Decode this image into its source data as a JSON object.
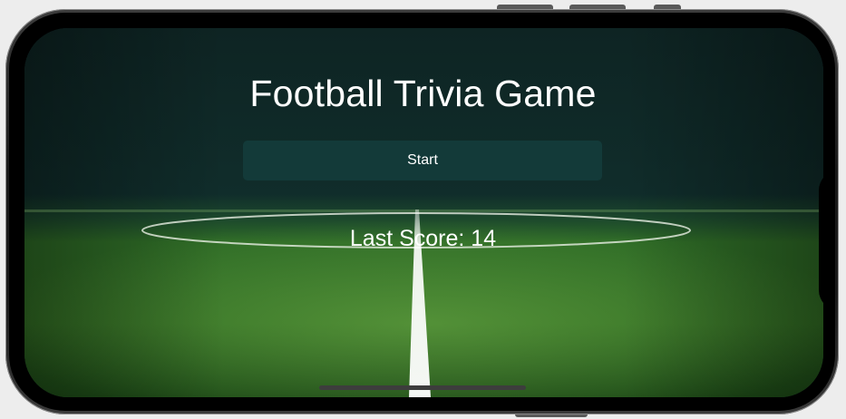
{
  "app": {
    "title": "Football Trivia Game"
  },
  "start_button": {
    "label": "Start"
  },
  "last_score": {
    "text": "Last Score: 14"
  },
  "colors": {
    "background_top": "#0f2625",
    "button_fill": "#133a39",
    "grass": "#2f6a22",
    "text": "#ffffff"
  }
}
